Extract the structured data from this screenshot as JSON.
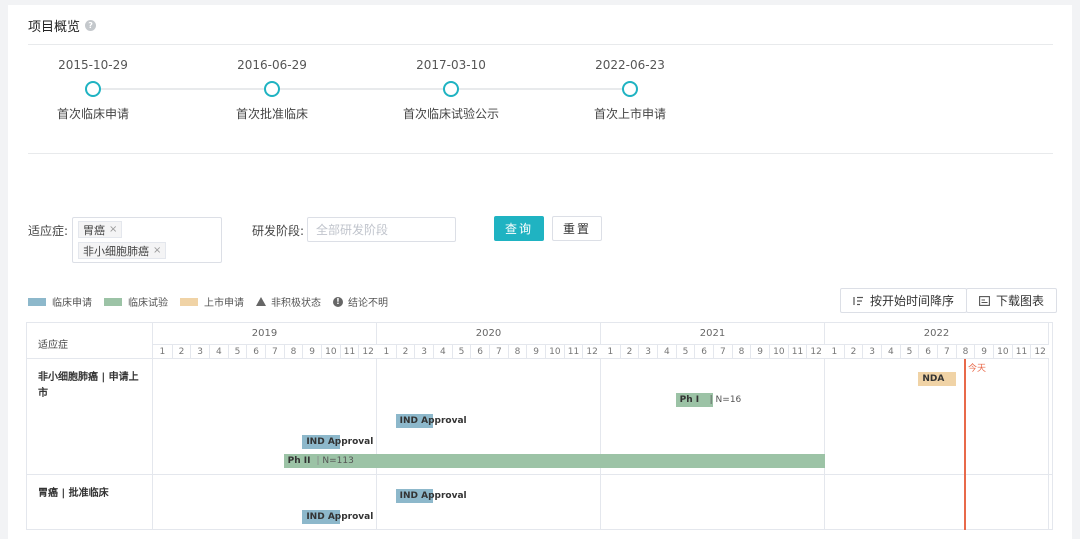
{
  "page": {
    "title": "项目概览",
    "help_icon": "?"
  },
  "milestones": [
    {
      "date": "2015-10-29",
      "label": "首次临床申请"
    },
    {
      "date": "2016-06-29",
      "label": "首次批准临床"
    },
    {
      "date": "2017-03-10",
      "label": "首次临床试验公示"
    },
    {
      "date": "2022-06-23",
      "label": "首次上市申请"
    }
  ],
  "filters": {
    "indication_label": "适应症:",
    "indication_tags": [
      "胃癌",
      "非小细胞肺癌"
    ],
    "tag_close": "×",
    "stage_label": "研发阶段:",
    "stage_placeholder": "全部研发阶段",
    "query_button": "查询",
    "reset_button": "重置"
  },
  "legend": {
    "clinical_application": "临床申请",
    "clinical_trial": "临床试验",
    "market_application": "上市申请",
    "inactive": "非积极状态",
    "unclear": "结论不明",
    "unclear_icon": "!"
  },
  "toolbar": {
    "sort_button": "按开始时间降序",
    "download_button": "下载图表",
    "sort_icon": "sort-desc-icon",
    "download_icon": "image-icon"
  },
  "colors": {
    "accent": "#1fb3c2",
    "clinical_application": "#8db8cb",
    "clinical_trial": "#9cc3a6",
    "market_application": "#f0d3a6",
    "today": "#e8694a"
  },
  "gantt": {
    "header_label": "适应症",
    "years": [
      "2019",
      "2020",
      "2021",
      "2022"
    ],
    "months": [
      "1",
      "2",
      "3",
      "4",
      "5",
      "6",
      "7",
      "8",
      "9",
      "10",
      "11",
      "12"
    ],
    "today_label": "今天",
    "today_month": "2022-08",
    "rows": [
      {
        "label": "非小细胞肺癌 | 申请上市",
        "bars": [
          {
            "type": "market_application",
            "start": "2022-06",
            "end": "2022-07",
            "label": "NDA",
            "note": ""
          },
          {
            "type": "clinical_trial",
            "start": "2021-05",
            "end": "2021-06",
            "label": "Ph I",
            "note": "N=16"
          },
          {
            "type": "clinical_application",
            "start": "2020-02",
            "end": "2020-03",
            "label": "IND Approval",
            "note": ""
          },
          {
            "type": "clinical_application",
            "start": "2019-09",
            "end": "2019-10",
            "label": "IND Approval",
            "note": ""
          },
          {
            "type": "clinical_trial",
            "start": "2019-08",
            "end": "2021-12",
            "label": "Ph II",
            "note": "N=113"
          }
        ]
      },
      {
        "label": "胃癌 | 批准临床",
        "bars": [
          {
            "type": "clinical_application",
            "start": "2020-02",
            "end": "2020-03",
            "label": "IND Approval",
            "note": ""
          },
          {
            "type": "clinical_application",
            "start": "2019-09",
            "end": "2019-10",
            "label": "IND Approval",
            "note": ""
          }
        ]
      }
    ]
  }
}
